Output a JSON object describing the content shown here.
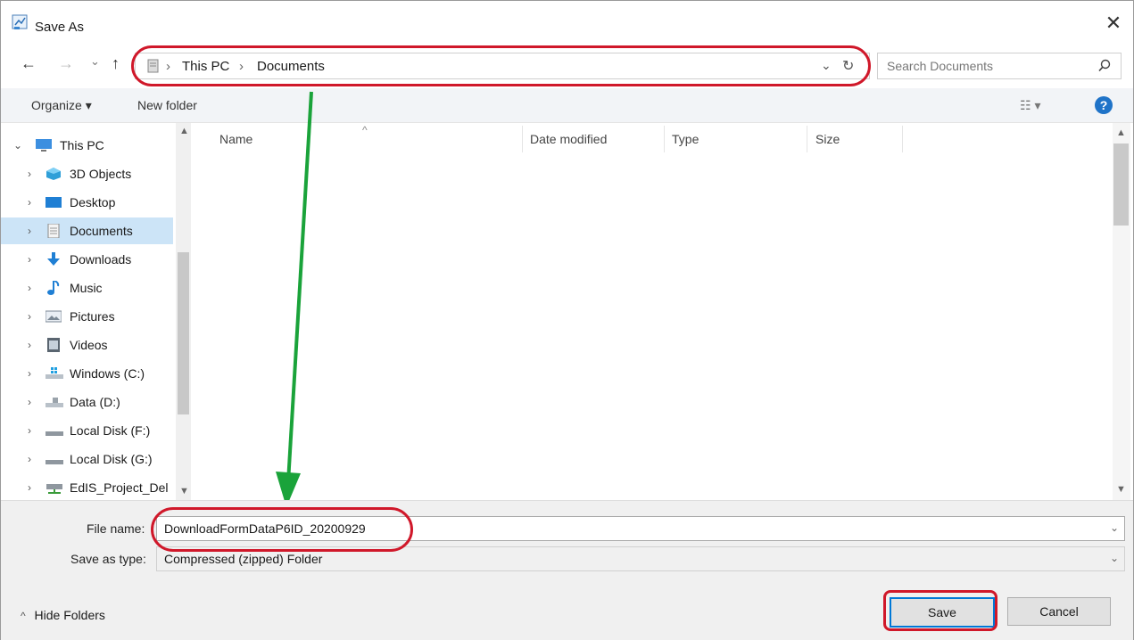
{
  "window": {
    "title": "Save As",
    "close_glyph": "✕",
    "title_icon": "save-as-icon"
  },
  "nav": {
    "back_glyph": "←",
    "forward_glyph": "→",
    "recent_glyph": "⌄",
    "up_glyph": "↑",
    "breadcrumb": [
      "This PC",
      "Documents"
    ],
    "breadcrumb_sep": "›",
    "dropdown_glyph": "⌄",
    "refresh_glyph": "↻",
    "search_placeholder": "Search Documents",
    "search_icon": "search-icon"
  },
  "toolbar": {
    "organize_label": "Organize ▾",
    "new_folder_label": "New folder",
    "view_glyph": "☷ ▾",
    "help_glyph": "?"
  },
  "sidebar": {
    "items": [
      {
        "label": "This PC",
        "icon": "computer-icon",
        "chev": "⌄"
      },
      {
        "label": "3D Objects",
        "icon": "cube-icon",
        "chev": "›"
      },
      {
        "label": "Desktop",
        "icon": "desktop-icon",
        "chev": "›"
      },
      {
        "label": "Documents",
        "icon": "documents-icon",
        "chev": "›"
      },
      {
        "label": "Downloads",
        "icon": "download-icon",
        "chev": "›"
      },
      {
        "label": "Music",
        "icon": "music-icon",
        "chev": "›"
      },
      {
        "label": "Pictures",
        "icon": "pictures-icon",
        "chev": "›"
      },
      {
        "label": "Videos",
        "icon": "videos-icon",
        "chev": "›"
      },
      {
        "label": "Windows (C:)",
        "icon": "drive-icon",
        "chev": "›"
      },
      {
        "label": "Data (D:)",
        "icon": "drive-icon",
        "chev": "›"
      },
      {
        "label": "Local Disk (F:)",
        "icon": "disk-icon",
        "chev": "›"
      },
      {
        "label": "Local Disk (G:)",
        "icon": "disk-icon",
        "chev": "›"
      },
      {
        "label": "EdIS_Project_Del",
        "icon": "network-drive-icon",
        "chev": "›"
      }
    ],
    "selected": "Documents"
  },
  "filelist": {
    "columns": [
      "Name",
      "Date modified",
      "Type",
      "Size"
    ],
    "sort_glyph": "^"
  },
  "form": {
    "file_name_label": "File name:",
    "file_name_value": "DownloadFormDataP6ID_20200929",
    "save_type_label": "Save as type:",
    "save_type_value": "Compressed (zipped) Folder",
    "dropdown_glyph": "⌄"
  },
  "footer": {
    "hide_folders_label": "Hide Folders",
    "hide_glyph": "^",
    "save_label": "Save",
    "cancel_label": "Cancel"
  },
  "colors": {
    "annotation_red": "#d0182a",
    "annotation_green": "#1aa33a",
    "selection": "#cce4f7",
    "help_blue": "#1f73c8"
  }
}
